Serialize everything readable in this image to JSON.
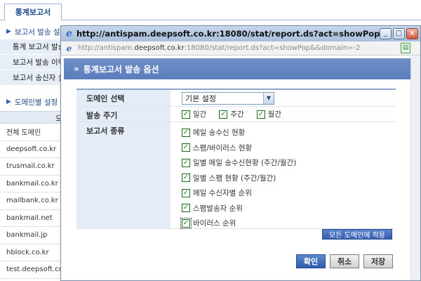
{
  "background": {
    "tab_label": "통계보고서",
    "menu": [
      {
        "label": "보고서 발송 설정",
        "kind": "top"
      },
      {
        "label": "통계 보고서 발송",
        "kind": "sub"
      },
      {
        "label": "보고서 발송 이력",
        "kind": "sub"
      },
      {
        "label": "보고서 송신자 설정",
        "kind": "sub"
      },
      {
        "label": "",
        "kind": "gap"
      },
      {
        "label": "도메인별 설정",
        "kind": "top"
      }
    ],
    "column_header": "도",
    "domains": [
      "전체 도메인",
      "deepsoft.co.kr",
      "trusmail.co.kr",
      "bankmail.co.kr",
      "mailbank.co.kr",
      "bankmail.net",
      "bankmail.jp",
      "hblock.co.kr",
      "test.deepsoft.co.kr"
    ]
  },
  "popup": {
    "title": "http://antispam.deepsoft.co.kr:18080/stat/report.ds?act=showPop&&...",
    "address": {
      "prefix": "http://antispam.",
      "host": "deepsoft.co.kr",
      "suffix": ":18080/stat/report.ds?act=showPop&&domain=-2"
    },
    "window_buttons": {
      "minimize": "_",
      "maximize": "□",
      "close": "×"
    },
    "banner_arrow": "»",
    "banner": "통계보고서 발송 옵션",
    "form": {
      "domain_label": "도메인 선택",
      "domain_value": "기본 설정",
      "period_label": "발송 주기",
      "periods": [
        {
          "label": "일간",
          "checked": true
        },
        {
          "label": "주간",
          "checked": true
        },
        {
          "label": "월간",
          "checked": true
        }
      ],
      "types_label": "보고서 종류",
      "types": [
        {
          "label": "메일 송수신 현황",
          "checked": true
        },
        {
          "label": "스팸/바이러스 현황",
          "checked": true
        },
        {
          "label": "일별 메일 송수신현황 (주간/월간)",
          "checked": true
        },
        {
          "label": "일별 스팸 현황 (주간/월간)",
          "checked": true
        },
        {
          "label": "메일 수신자별 순위",
          "checked": true
        },
        {
          "label": "스팸발송자 순위",
          "checked": true
        },
        {
          "label": "바이러스 순위",
          "checked": true
        }
      ]
    },
    "apply_all_label": "모든 도메인에 적용",
    "buttons": {
      "confirm": "확인",
      "cancel": "취소",
      "save": "저장"
    },
    "check_mark": "✓"
  }
}
